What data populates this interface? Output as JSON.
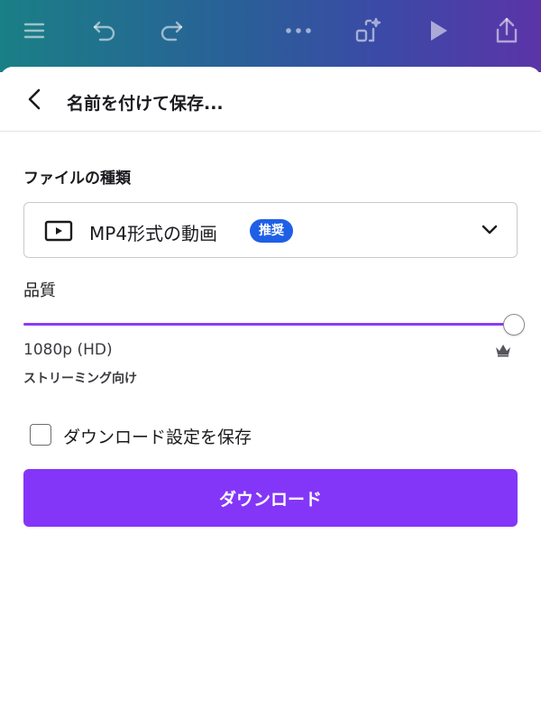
{
  "toolbar": {
    "icons": [
      "menu-icon",
      "undo-icon",
      "redo-icon",
      "more-icon",
      "magic-resize-icon",
      "play-icon",
      "share-icon"
    ]
  },
  "sheet": {
    "title": "名前を付けて保存...",
    "file_type_label": "ファイルの種類",
    "file_type_value": "MP4形式の動画",
    "recommended_badge": "推奨",
    "quality_label": "品質",
    "quality_level": 1.0,
    "quality_value": "1080p (HD)",
    "quality_hint": "ストリーミング向け",
    "save_settings_label": "ダウンロード設定を保存",
    "save_settings_checked": false,
    "download_button": "ダウンロード"
  },
  "colors": {
    "accent": "#8436f8",
    "badge": "#1f5fe6"
  }
}
